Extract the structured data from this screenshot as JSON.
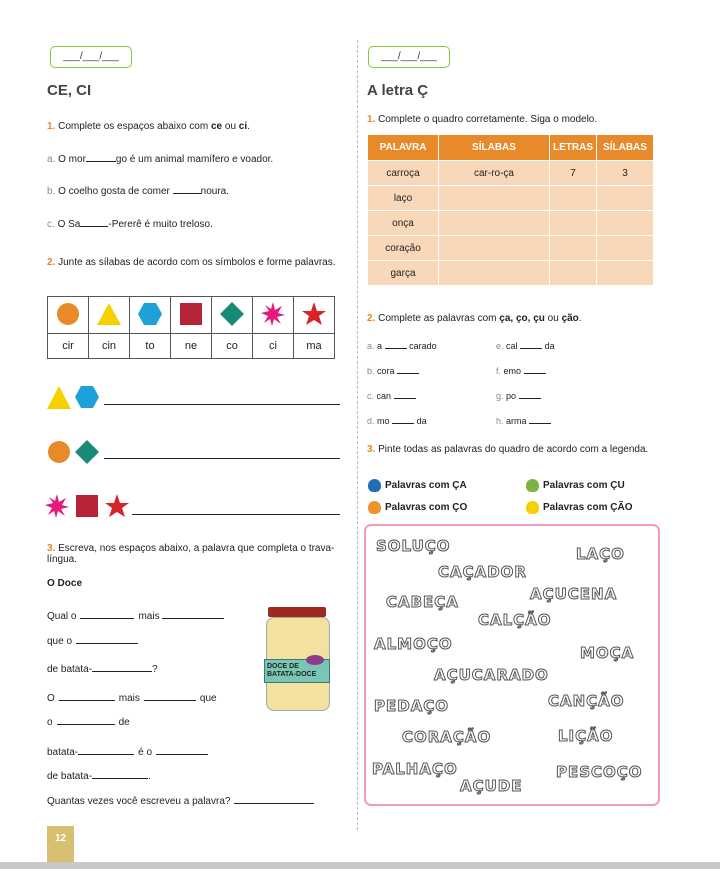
{
  "date_placeholder": "___/___/___",
  "left": {
    "section_title": "CE, CI",
    "q1": {
      "num": "1.",
      "text_pre": "Complete os espaços abaixo com ",
      "opt1": "ce",
      "text_mid": " ou ",
      "opt2": "ci",
      "text_end": ".",
      "items": [
        {
          "label": "a.",
          "pre": "O mor",
          "post": "go é um animal mamífero e voador."
        },
        {
          "label": "b.",
          "pre": "O coelho gosta de comer ",
          "post": "noura."
        },
        {
          "label": "c.",
          "pre": "O Sa",
          "post": "-Pererê é muito treloso."
        }
      ]
    },
    "q2": {
      "num": "2.",
      "text": "Junte as sílabas de acordo com os símbolos e forme palavras.",
      "syllables": [
        "cir",
        "cin",
        "to",
        "ne",
        "co",
        "ci",
        "ma"
      ]
    },
    "q3": {
      "num": "3.",
      "text": "Escreva, nos espaços abaixo, a palavra que completa o trava-língua.",
      "poem_title": "O Doce",
      "lines": [
        {
          "a": "Qual o",
          "b": "mais"
        },
        {
          "a": "que o"
        },
        {
          "a": "de batata-",
          "b": "?"
        },
        {
          "a": "O",
          "b": "mais",
          "c": "que"
        },
        {
          "a": "o",
          "b": "de"
        },
        {
          "a": "batata-",
          "b": "é o"
        },
        {
          "a": "de batata-",
          "b": "."
        }
      ],
      "question": "Quantas vezes você escreveu a palavra?",
      "jar_label": "DOCE DE BATATA-DOCE"
    }
  },
  "right": {
    "section_title": "A letra Ç",
    "q1": {
      "num": "1.",
      "text": "Complete o quadro corretamente. Siga o modelo.",
      "headers": [
        "PALAVRA",
        "SÍLABAS",
        "LETRAS",
        "SÍLABAS"
      ],
      "rows": [
        [
          "carroça",
          "car-ro-ça",
          "7",
          "3"
        ],
        [
          "laço",
          "",
          "",
          ""
        ],
        [
          "onça",
          "",
          "",
          ""
        ],
        [
          "coração",
          "",
          "",
          ""
        ],
        [
          "garça",
          "",
          "",
          ""
        ]
      ]
    },
    "q2": {
      "num": "2.",
      "text_pre": "Complete as palavras com ",
      "opts": "ça, ço, çu",
      "text_mid": " ou ",
      "opt_last": "ção",
      "text_end": ".",
      "items": [
        {
          "label": "a.",
          "pre": "a",
          "post": "carado"
        },
        {
          "label": "e.",
          "pre": "cal",
          "post": "da"
        },
        {
          "label": "b.",
          "pre": "cora",
          "post": ""
        },
        {
          "label": "f.",
          "pre": "emo",
          "post": ""
        },
        {
          "label": "c.",
          "pre": "can",
          "post": ""
        },
        {
          "label": "g.",
          "pre": "po",
          "post": ""
        },
        {
          "label": "d.",
          "pre": "mo",
          "post": "da"
        },
        {
          "label": "h.",
          "pre": "arma",
          "post": ""
        }
      ]
    },
    "q3": {
      "num": "3.",
      "text": "Pinte todas as palavras do quadro de acordo com a legenda.",
      "legend": [
        {
          "label": "Palavras com ÇA",
          "color": "#1f6fb8"
        },
        {
          "label": "Palavras com ÇU",
          "color": "#7bb342"
        },
        {
          "label": "Palavras com ÇO",
          "color": "#f0922e"
        },
        {
          "label": "Palavras com ÇÃO",
          "color": "#f5d100"
        }
      ],
      "words": [
        "SOLUÇO",
        "LAÇO",
        "CAÇADOR",
        "CABEÇA",
        "AÇUCENA",
        "CALÇÃO",
        "ALMOÇO",
        "MOÇA",
        "AÇUCARADO",
        "PEDAÇO",
        "CANÇÃO",
        "CORAÇÃO",
        "LIÇÃO",
        "PALHAÇO",
        "PESCOÇO",
        "AÇUDE"
      ]
    }
  },
  "page_number": "12",
  "colors": {
    "accent_orange": "#e8892a",
    "accent_green": "#8cc63f",
    "box_pink": "#f29ac4"
  }
}
